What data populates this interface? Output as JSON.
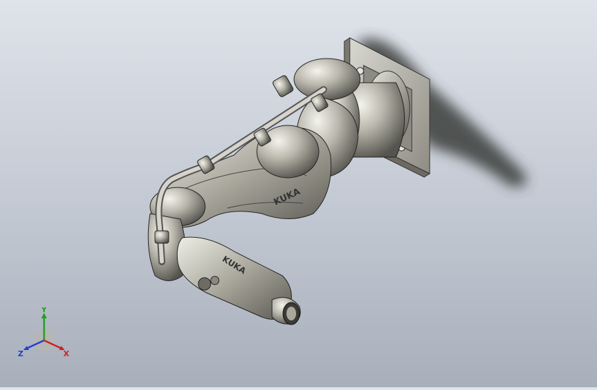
{
  "viewport": {
    "background_top": "#dfe3ea",
    "background_bottom": "#a8afbb"
  },
  "model": {
    "brand_text_upper_arm": "KUKA",
    "brand_text_forearm": "KUKA",
    "body_color": "#b9b7ac",
    "shadow_color": "#3a3e3a"
  },
  "triad": {
    "x_label": "X",
    "y_label": "Y",
    "z_label": "Z",
    "x_color": "#d02020",
    "y_color": "#20a020",
    "z_color": "#2040d0"
  }
}
